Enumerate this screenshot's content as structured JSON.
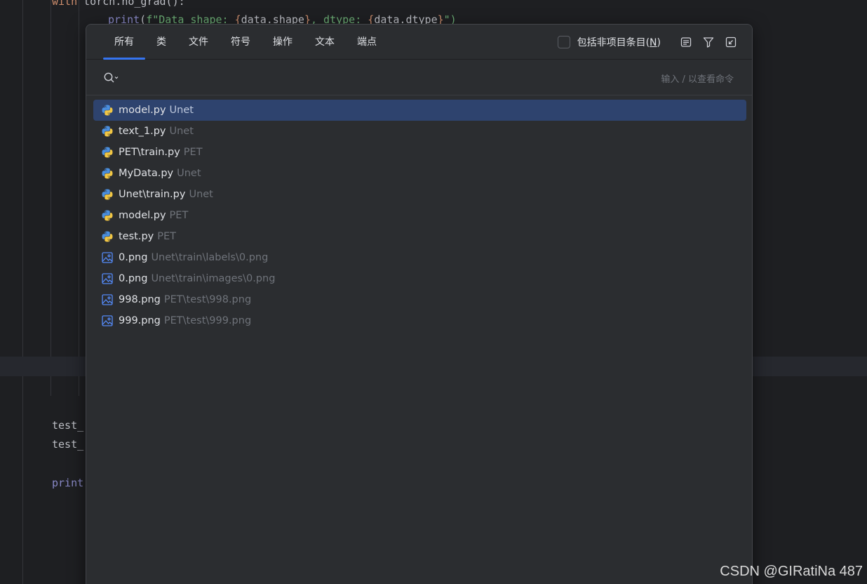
{
  "editor": {
    "line1_kw": "with",
    "line1_text": " torch.no_grad():",
    "line2": {
      "fn": "print",
      "open": "(",
      "prefix": "f\"Data shape: ",
      "b1": "{",
      "v1": "data.shape",
      "b1c": "}",
      "mid": ", dtype: ",
      "b2": "{",
      "v2": "data.dtype",
      "b2c": "}",
      "end": "\")"
    },
    "line3": "test_",
    "line4": "test_",
    "line5": "print"
  },
  "popup": {
    "tabs": [
      {
        "label": "所有",
        "active": true
      },
      {
        "label": "类",
        "active": false
      },
      {
        "label": "文件",
        "active": false
      },
      {
        "label": "符号",
        "active": false
      },
      {
        "label": "操作",
        "active": false
      },
      {
        "label": "文本",
        "active": false
      },
      {
        "label": "端点",
        "active": false
      }
    ],
    "include_non_project": {
      "label": "包括非项目条目",
      "mnemonic_open": "(",
      "mnemonic": "N",
      "mnemonic_close": ")",
      "checked": false
    },
    "header_icons": [
      "preview-icon",
      "filter-icon",
      "open-in-window-icon"
    ],
    "search": {
      "value": "",
      "hint": "输入 / 以查看命令"
    },
    "results": [
      {
        "name": "model.py",
        "location": "Unet",
        "icon": "python-file-icon",
        "selected": true
      },
      {
        "name": "text_1.py",
        "location": "Unet",
        "icon": "python-file-icon",
        "selected": false
      },
      {
        "name": "PET\\train.py",
        "location": "PET",
        "icon": "python-file-icon",
        "selected": false
      },
      {
        "name": "MyData.py",
        "location": "Unet",
        "icon": "python-file-icon",
        "selected": false
      },
      {
        "name": "Unet\\train.py",
        "location": "Unet",
        "icon": "python-file-icon",
        "selected": false
      },
      {
        "name": "model.py",
        "location": "PET",
        "icon": "python-file-icon",
        "selected": false
      },
      {
        "name": "test.py",
        "location": "PET",
        "icon": "python-file-icon",
        "selected": false
      },
      {
        "name": "0.png",
        "location": "Unet\\train\\labels\\0.png",
        "icon": "image-file-icon",
        "selected": false
      },
      {
        "name": "0.png",
        "location": "Unet\\train\\images\\0.png",
        "icon": "image-file-icon",
        "selected": false
      },
      {
        "name": "998.png",
        "location": "PET\\test\\998.png",
        "icon": "image-file-icon",
        "selected": false
      },
      {
        "name": "999.png",
        "location": "PET\\test\\999.png",
        "icon": "image-file-icon",
        "selected": false
      }
    ]
  },
  "watermark": "CSDN @GIRatiNa 487",
  "colors": {
    "accent": "#3574f0",
    "selection": "#2e436e",
    "popup_bg": "#2b2d30",
    "editor_bg": "#1e1f22"
  }
}
